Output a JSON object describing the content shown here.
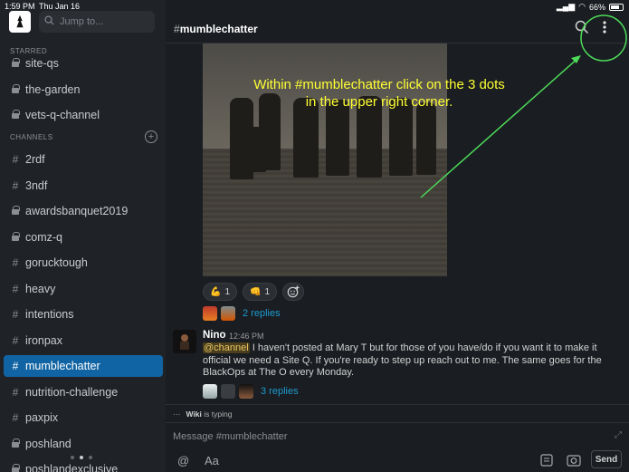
{
  "status_bar": {
    "time": "1:59 PM",
    "date": "Thu Jan 16",
    "battery": "66%"
  },
  "sidebar": {
    "jump_placeholder": "Jump to...",
    "starred_label": "STARRED",
    "channels_label": "CHANNELS",
    "starred": [
      {
        "name": "site-qs",
        "type": "private"
      },
      {
        "name": "the-garden",
        "type": "private"
      },
      {
        "name": "vets-q-channel",
        "type": "private"
      }
    ],
    "channels": [
      {
        "name": "2rdf",
        "type": "public"
      },
      {
        "name": "3ndf",
        "type": "public"
      },
      {
        "name": "awardsbanquet2019",
        "type": "private"
      },
      {
        "name": "comz-q",
        "type": "private"
      },
      {
        "name": "gorucktough",
        "type": "public"
      },
      {
        "name": "heavy",
        "type": "public"
      },
      {
        "name": "intentions",
        "type": "public"
      },
      {
        "name": "ironpax",
        "type": "public"
      },
      {
        "name": "mumblechatter",
        "type": "public",
        "active": true
      },
      {
        "name": "nutrition-challenge",
        "type": "public"
      },
      {
        "name": "paxpix",
        "type": "public"
      },
      {
        "name": "poshland",
        "type": "private"
      },
      {
        "name": "poshlandexclusive",
        "type": "private"
      }
    ]
  },
  "header": {
    "hash": "#",
    "channel": "mumblechatter"
  },
  "annotation": "Within #mumblechatter click on the 3 dots in the upper right corner.",
  "reactions": [
    {
      "icon": "flexed-bicep",
      "emoji": "💪",
      "count": "1"
    },
    {
      "icon": "fist-bump",
      "emoji": "👊",
      "count": "1"
    }
  ],
  "thread1": {
    "replies": "2 replies"
  },
  "message": {
    "author": "Nino",
    "time": "12:46 PM",
    "mention": "@channel",
    "text": " I haven't posted at Mary T but for those of you have/do if you want it to make it official we need a Site Q. If you're ready to step up reach out to me. The same goes for the BlackOps at The O every Monday.",
    "replies": "3 replies"
  },
  "typing": {
    "dots": "···",
    "user": "Wiki",
    "text": " is typing"
  },
  "composer": {
    "placeholder": "Message #mumblechatter",
    "send_label": "Send",
    "format_label": "Aa",
    "at_label": "@"
  },
  "colors": {
    "accent": "#1164a3",
    "link": "#1d9bd1",
    "annotation_text": "#ffff33",
    "annotation_arrow": "#4ddb5a"
  }
}
